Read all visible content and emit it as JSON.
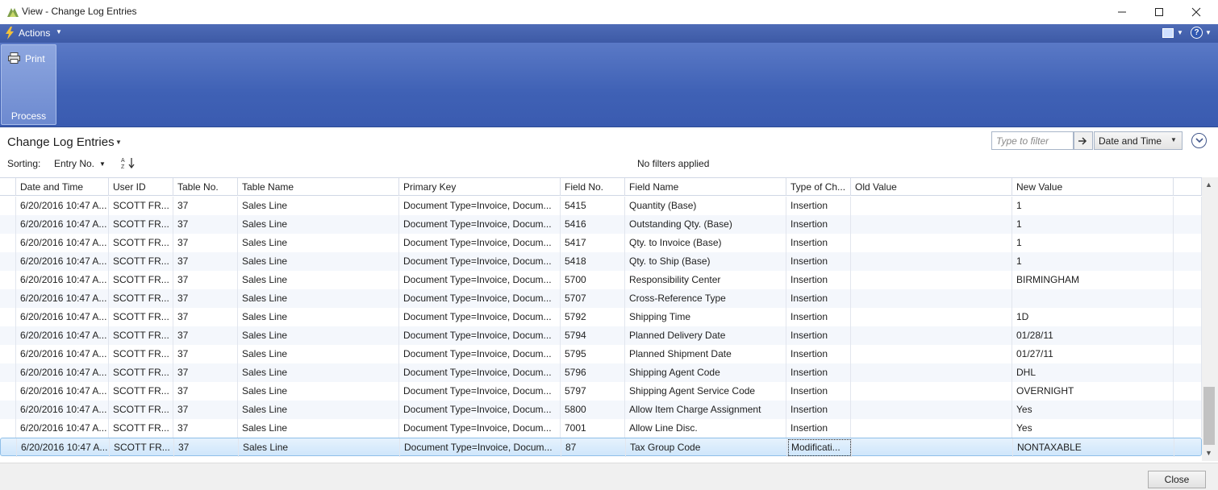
{
  "window": {
    "title": "View - Change Log Entries"
  },
  "actions_bar": {
    "actions_label": "Actions",
    "help_label": "?"
  },
  "ribbon": {
    "print_label": "Print",
    "group_label": "Process"
  },
  "page": {
    "title": "Change Log Entries",
    "sorting_label": "Sorting:",
    "sorting_value": "Entry No.",
    "filter_status": "No filters applied",
    "filter_placeholder": "Type to filter",
    "filter_field": "Date and Time"
  },
  "grid": {
    "columns": [
      "Date and Time",
      "User ID",
      "Table No.",
      "Table Name",
      "Primary Key",
      "Field No.",
      "Field Name",
      "Type of Ch...",
      "Old Value",
      "New Value"
    ],
    "rows": [
      [
        "6/20/2016 10:47 A...",
        "SCOTT FR...",
        "37",
        "Sales Line",
        "Document Type=Invoice, Docum...",
        "5415",
        "Quantity (Base)",
        "Insertion",
        "",
        "1"
      ],
      [
        "6/20/2016 10:47 A...",
        "SCOTT FR...",
        "37",
        "Sales Line",
        "Document Type=Invoice, Docum...",
        "5416",
        "Outstanding Qty. (Base)",
        "Insertion",
        "",
        "1"
      ],
      [
        "6/20/2016 10:47 A...",
        "SCOTT FR...",
        "37",
        "Sales Line",
        "Document Type=Invoice, Docum...",
        "5417",
        "Qty. to Invoice (Base)",
        "Insertion",
        "",
        "1"
      ],
      [
        "6/20/2016 10:47 A...",
        "SCOTT FR...",
        "37",
        "Sales Line",
        "Document Type=Invoice, Docum...",
        "5418",
        "Qty. to Ship (Base)",
        "Insertion",
        "",
        "1"
      ],
      [
        "6/20/2016 10:47 A...",
        "SCOTT FR...",
        "37",
        "Sales Line",
        "Document Type=Invoice, Docum...",
        "5700",
        "Responsibility Center",
        "Insertion",
        "",
        "BIRMINGHAM"
      ],
      [
        "6/20/2016 10:47 A...",
        "SCOTT FR...",
        "37",
        "Sales Line",
        "Document Type=Invoice, Docum...",
        "5707",
        "Cross-Reference Type",
        "Insertion",
        "",
        ""
      ],
      [
        "6/20/2016 10:47 A...",
        "SCOTT FR...",
        "37",
        "Sales Line",
        "Document Type=Invoice, Docum...",
        "5792",
        "Shipping Time",
        "Insertion",
        "",
        "1D"
      ],
      [
        "6/20/2016 10:47 A...",
        "SCOTT FR...",
        "37",
        "Sales Line",
        "Document Type=Invoice, Docum...",
        "5794",
        "Planned Delivery Date",
        "Insertion",
        "",
        "01/28/11"
      ],
      [
        "6/20/2016 10:47 A...",
        "SCOTT FR...",
        "37",
        "Sales Line",
        "Document Type=Invoice, Docum...",
        "5795",
        "Planned Shipment Date",
        "Insertion",
        "",
        "01/27/11"
      ],
      [
        "6/20/2016 10:47 A...",
        "SCOTT FR...",
        "37",
        "Sales Line",
        "Document Type=Invoice, Docum...",
        "5796",
        "Shipping Agent Code",
        "Insertion",
        "",
        "DHL"
      ],
      [
        "6/20/2016 10:47 A...",
        "SCOTT FR...",
        "37",
        "Sales Line",
        "Document Type=Invoice, Docum...",
        "5797",
        "Shipping Agent Service Code",
        "Insertion",
        "",
        "OVERNIGHT"
      ],
      [
        "6/20/2016 10:47 A...",
        "SCOTT FR...",
        "37",
        "Sales Line",
        "Document Type=Invoice, Docum...",
        "5800",
        "Allow Item Charge Assignment",
        "Insertion",
        "",
        "Yes"
      ],
      [
        "6/20/2016 10:47 A...",
        "SCOTT FR...",
        "37",
        "Sales Line",
        "Document Type=Invoice, Docum...",
        "7001",
        "Allow Line Disc.",
        "Insertion",
        "",
        "Yes"
      ],
      [
        "6/20/2016 10:47 A...",
        "SCOTT FR...",
        "37",
        "Sales Line",
        "Document Type=Invoice, Docum...",
        "87",
        "Tax Group Code",
        "Modificati...",
        "",
        "NONTAXABLE"
      ]
    ],
    "selected_row_index": 13
  },
  "footer": {
    "close_label": "Close"
  },
  "colors": {
    "ribbon_blue": "#3f61b5",
    "selected_row": "#cfe6fb"
  }
}
